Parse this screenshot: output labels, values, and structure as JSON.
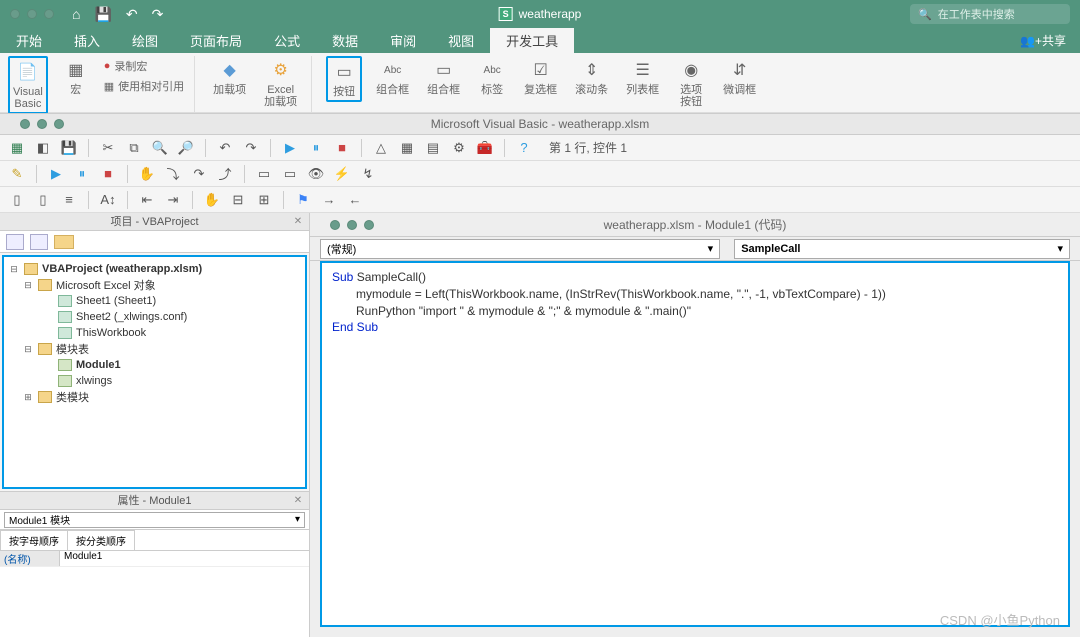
{
  "titlebar": {
    "app_name": "weatherapp",
    "search_placeholder": "在工作表中搜索"
  },
  "menu": {
    "items": [
      "开始",
      "插入",
      "绘图",
      "页面布局",
      "公式",
      "数据",
      "审阅",
      "视图",
      "开发工具"
    ],
    "active": "开发工具",
    "share": "共享"
  },
  "ribbon": {
    "visual_basic": "Visual\nBasic",
    "macro": "宏",
    "record_macro": "录制宏",
    "use_relative": "使用相对引用",
    "addins": "加载项",
    "excel_addins": "Excel\n加载项",
    "button": "按钮",
    "groupbox": "组合框",
    "combobox": "组合框",
    "label": "标签",
    "checkbox": "复选框",
    "scrollbar": "滚动条",
    "listbox": "列表框",
    "option": "选项\n按钮",
    "spinner": "微调框"
  },
  "vbe": {
    "title": "Microsoft Visual Basic - weatherapp.xlsm",
    "status": "第 1 行,  控件 1"
  },
  "project_panel": {
    "title": "项目 - VBAProject",
    "root": "VBAProject (weatherapp.xlsm)",
    "excel_objects": "Microsoft Excel 对象",
    "sheet1": "Sheet1 (Sheet1)",
    "sheet2": "Sheet2 (_xlwings.conf)",
    "thisworkbook": "ThisWorkbook",
    "modules": "模块表",
    "module1": "Module1",
    "xlwings": "xlwings",
    "class_modules": "类模块"
  },
  "properties_panel": {
    "title": "属性 - Module1",
    "combo": "Module1 模块",
    "tab1": "按字母顺序",
    "tab2": "按分类顺序",
    "name_key": "(名称)",
    "name_val": "Module1"
  },
  "code": {
    "window_title": "weatherapp.xlsm - Module1 (代码)",
    "left_combo": "(常规)",
    "right_combo": "SampleCall",
    "line1_kw": "Sub",
    "line1_rest": " SampleCall()",
    "line2": "mymodule = Left(ThisWorkbook.name, (InStrRev(ThisWorkbook.name, \".\", -1, vbTextCompare) - 1))",
    "line3": "RunPython \"import \" & mymodule & \";\" & mymodule & \".main()\"",
    "line4_kw": "End Sub"
  },
  "watermark": "CSDN @小鱼Python"
}
